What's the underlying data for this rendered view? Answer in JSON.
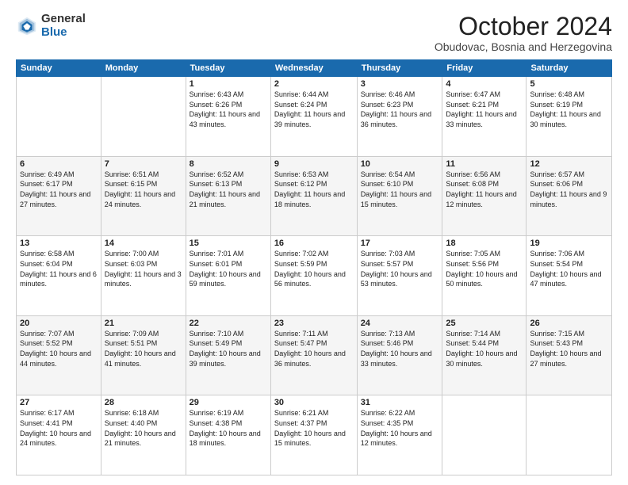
{
  "header": {
    "logo_general": "General",
    "logo_blue": "Blue",
    "month_title": "October 2024",
    "subtitle": "Obudovac, Bosnia and Herzegovina"
  },
  "days_of_week": [
    "Sunday",
    "Monday",
    "Tuesday",
    "Wednesday",
    "Thursday",
    "Friday",
    "Saturday"
  ],
  "weeks": [
    [
      {
        "day": "",
        "sunrise": "",
        "sunset": "",
        "daylight": ""
      },
      {
        "day": "",
        "sunrise": "",
        "sunset": "",
        "daylight": ""
      },
      {
        "day": "1",
        "sunrise": "Sunrise: 6:43 AM",
        "sunset": "Sunset: 6:26 PM",
        "daylight": "Daylight: 11 hours and 43 minutes."
      },
      {
        "day": "2",
        "sunrise": "Sunrise: 6:44 AM",
        "sunset": "Sunset: 6:24 PM",
        "daylight": "Daylight: 11 hours and 39 minutes."
      },
      {
        "day": "3",
        "sunrise": "Sunrise: 6:46 AM",
        "sunset": "Sunset: 6:23 PM",
        "daylight": "Daylight: 11 hours and 36 minutes."
      },
      {
        "day": "4",
        "sunrise": "Sunrise: 6:47 AM",
        "sunset": "Sunset: 6:21 PM",
        "daylight": "Daylight: 11 hours and 33 minutes."
      },
      {
        "day": "5",
        "sunrise": "Sunrise: 6:48 AM",
        "sunset": "Sunset: 6:19 PM",
        "daylight": "Daylight: 11 hours and 30 minutes."
      }
    ],
    [
      {
        "day": "6",
        "sunrise": "Sunrise: 6:49 AM",
        "sunset": "Sunset: 6:17 PM",
        "daylight": "Daylight: 11 hours and 27 minutes."
      },
      {
        "day": "7",
        "sunrise": "Sunrise: 6:51 AM",
        "sunset": "Sunset: 6:15 PM",
        "daylight": "Daylight: 11 hours and 24 minutes."
      },
      {
        "day": "8",
        "sunrise": "Sunrise: 6:52 AM",
        "sunset": "Sunset: 6:13 PM",
        "daylight": "Daylight: 11 hours and 21 minutes."
      },
      {
        "day": "9",
        "sunrise": "Sunrise: 6:53 AM",
        "sunset": "Sunset: 6:12 PM",
        "daylight": "Daylight: 11 hours and 18 minutes."
      },
      {
        "day": "10",
        "sunrise": "Sunrise: 6:54 AM",
        "sunset": "Sunset: 6:10 PM",
        "daylight": "Daylight: 11 hours and 15 minutes."
      },
      {
        "day": "11",
        "sunrise": "Sunrise: 6:56 AM",
        "sunset": "Sunset: 6:08 PM",
        "daylight": "Daylight: 11 hours and 12 minutes."
      },
      {
        "day": "12",
        "sunrise": "Sunrise: 6:57 AM",
        "sunset": "Sunset: 6:06 PM",
        "daylight": "Daylight: 11 hours and 9 minutes."
      }
    ],
    [
      {
        "day": "13",
        "sunrise": "Sunrise: 6:58 AM",
        "sunset": "Sunset: 6:04 PM",
        "daylight": "Daylight: 11 hours and 6 minutes."
      },
      {
        "day": "14",
        "sunrise": "Sunrise: 7:00 AM",
        "sunset": "Sunset: 6:03 PM",
        "daylight": "Daylight: 11 hours and 3 minutes."
      },
      {
        "day": "15",
        "sunrise": "Sunrise: 7:01 AM",
        "sunset": "Sunset: 6:01 PM",
        "daylight": "Daylight: 10 hours and 59 minutes."
      },
      {
        "day": "16",
        "sunrise": "Sunrise: 7:02 AM",
        "sunset": "Sunset: 5:59 PM",
        "daylight": "Daylight: 10 hours and 56 minutes."
      },
      {
        "day": "17",
        "sunrise": "Sunrise: 7:03 AM",
        "sunset": "Sunset: 5:57 PM",
        "daylight": "Daylight: 10 hours and 53 minutes."
      },
      {
        "day": "18",
        "sunrise": "Sunrise: 7:05 AM",
        "sunset": "Sunset: 5:56 PM",
        "daylight": "Daylight: 10 hours and 50 minutes."
      },
      {
        "day": "19",
        "sunrise": "Sunrise: 7:06 AM",
        "sunset": "Sunset: 5:54 PM",
        "daylight": "Daylight: 10 hours and 47 minutes."
      }
    ],
    [
      {
        "day": "20",
        "sunrise": "Sunrise: 7:07 AM",
        "sunset": "Sunset: 5:52 PM",
        "daylight": "Daylight: 10 hours and 44 minutes."
      },
      {
        "day": "21",
        "sunrise": "Sunrise: 7:09 AM",
        "sunset": "Sunset: 5:51 PM",
        "daylight": "Daylight: 10 hours and 41 minutes."
      },
      {
        "day": "22",
        "sunrise": "Sunrise: 7:10 AM",
        "sunset": "Sunset: 5:49 PM",
        "daylight": "Daylight: 10 hours and 39 minutes."
      },
      {
        "day": "23",
        "sunrise": "Sunrise: 7:11 AM",
        "sunset": "Sunset: 5:47 PM",
        "daylight": "Daylight: 10 hours and 36 minutes."
      },
      {
        "day": "24",
        "sunrise": "Sunrise: 7:13 AM",
        "sunset": "Sunset: 5:46 PM",
        "daylight": "Daylight: 10 hours and 33 minutes."
      },
      {
        "day": "25",
        "sunrise": "Sunrise: 7:14 AM",
        "sunset": "Sunset: 5:44 PM",
        "daylight": "Daylight: 10 hours and 30 minutes."
      },
      {
        "day": "26",
        "sunrise": "Sunrise: 7:15 AM",
        "sunset": "Sunset: 5:43 PM",
        "daylight": "Daylight: 10 hours and 27 minutes."
      }
    ],
    [
      {
        "day": "27",
        "sunrise": "Sunrise: 6:17 AM",
        "sunset": "Sunset: 4:41 PM",
        "daylight": "Daylight: 10 hours and 24 minutes."
      },
      {
        "day": "28",
        "sunrise": "Sunrise: 6:18 AM",
        "sunset": "Sunset: 4:40 PM",
        "daylight": "Daylight: 10 hours and 21 minutes."
      },
      {
        "day": "29",
        "sunrise": "Sunrise: 6:19 AM",
        "sunset": "Sunset: 4:38 PM",
        "daylight": "Daylight: 10 hours and 18 minutes."
      },
      {
        "day": "30",
        "sunrise": "Sunrise: 6:21 AM",
        "sunset": "Sunset: 4:37 PM",
        "daylight": "Daylight: 10 hours and 15 minutes."
      },
      {
        "day": "31",
        "sunrise": "Sunrise: 6:22 AM",
        "sunset": "Sunset: 4:35 PM",
        "daylight": "Daylight: 10 hours and 12 minutes."
      },
      {
        "day": "",
        "sunrise": "",
        "sunset": "",
        "daylight": ""
      },
      {
        "day": "",
        "sunrise": "",
        "sunset": "",
        "daylight": ""
      }
    ]
  ]
}
